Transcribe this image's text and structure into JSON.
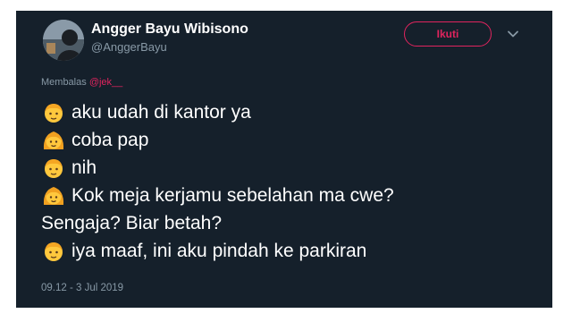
{
  "tweet": {
    "author_name": "Angger Bayu Wibisono",
    "author_handle": "@AnggerBayu",
    "follow_label": "Ikuti",
    "reply_prefix": "Membalas",
    "reply_mention": "@jek__",
    "lines": [
      {
        "emoji": "boy-icon",
        "text": "aku udah di kantor ya"
      },
      {
        "emoji": "girl-icon",
        "text": "coba pap"
      },
      {
        "emoji": "boy-icon",
        "text": "nih"
      },
      {
        "emoji": "girl-icon",
        "text": "Kok meja kerjamu sebelahan ma cwe?"
      },
      {
        "emoji": "",
        "text": "Sengaja? Biar betah?"
      },
      {
        "emoji": "boy-icon",
        "text": "iya maaf, ini aku pindah ke parkiran"
      }
    ],
    "timestamp": "09.12 - 3 Jul 2019"
  },
  "colors": {
    "background": "#15202b",
    "accent": "#e0245e",
    "muted": "#8899a6",
    "text": "#ffffff"
  }
}
